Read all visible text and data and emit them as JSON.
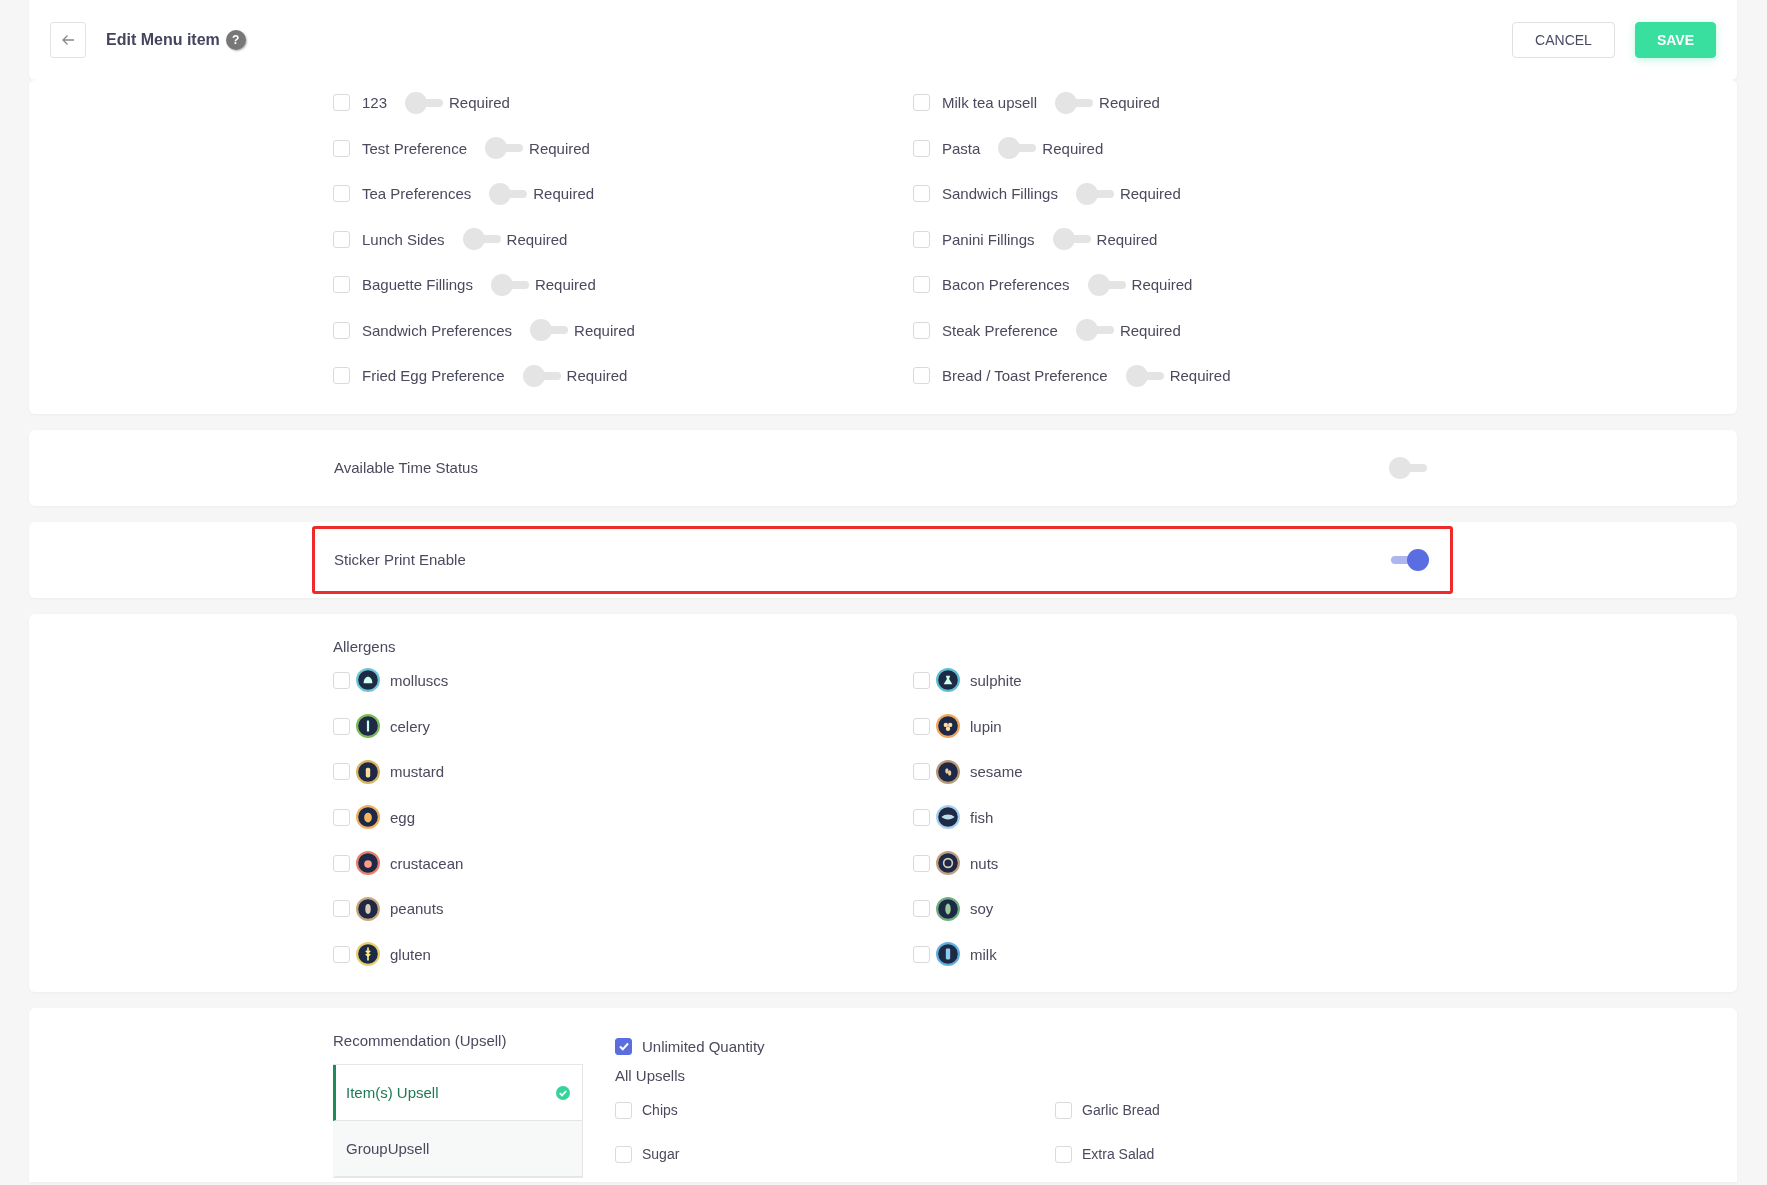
{
  "header": {
    "title": "Edit Menu item",
    "help_mark": "?",
    "buttons": [
      {
        "label": "CANCEL",
        "kind": "secondary"
      },
      {
        "label": "SAVE",
        "kind": "primary"
      }
    ]
  },
  "modifiers": [
    {
      "name": "123",
      "checked": false,
      "required": false,
      "required_label": "Required"
    },
    {
      "name": "Milk tea upsell",
      "checked": false,
      "required": false,
      "required_label": "Required"
    },
    {
      "name": "Test Preference",
      "checked": false,
      "required": false,
      "required_label": "Required"
    },
    {
      "name": "Pasta",
      "checked": false,
      "required": false,
      "required_label": "Required"
    },
    {
      "name": "Tea Preferences",
      "checked": false,
      "required": false,
      "required_label": "Required"
    },
    {
      "name": "Sandwich Fillings",
      "checked": false,
      "required": false,
      "required_label": "Required"
    },
    {
      "name": "Lunch Sides",
      "checked": false,
      "required": false,
      "required_label": "Required"
    },
    {
      "name": "Panini Fillings",
      "checked": false,
      "required": false,
      "required_label": "Required"
    },
    {
      "name": "Baguette Fillings",
      "checked": false,
      "required": false,
      "required_label": "Required"
    },
    {
      "name": "Bacon Preferences",
      "checked": false,
      "required": false,
      "required_label": "Required"
    },
    {
      "name": "Sandwich Preferences",
      "checked": false,
      "required": false,
      "required_label": "Required"
    },
    {
      "name": "Steak Preference",
      "checked": false,
      "required": false,
      "required_label": "Required"
    },
    {
      "name": "Fried Egg Preference",
      "checked": false,
      "required": false,
      "required_label": "Required"
    },
    {
      "name": "Bread / Toast Preference",
      "checked": false,
      "required": false,
      "required_label": "Required"
    }
  ],
  "settings": [
    {
      "label": "Available Time Status",
      "on": false,
      "highlighted": false
    },
    {
      "label": "Sticker Print Enable",
      "on": true,
      "highlighted": true
    }
  ],
  "allergens": {
    "title": "Allergens",
    "items": [
      {
        "name": "molluscs",
        "checked": false,
        "color": "#6ec6d6"
      },
      {
        "name": "sulphite",
        "checked": false,
        "color": "#5fbfd0"
      },
      {
        "name": "celery",
        "checked": false,
        "color": "#7dbb5a"
      },
      {
        "name": "lupin",
        "checked": false,
        "color": "#f0a860"
      },
      {
        "name": "mustard",
        "checked": false,
        "color": "#d8b45e"
      },
      {
        "name": "sesame",
        "checked": false,
        "color": "#b89878"
      },
      {
        "name": "egg",
        "checked": false,
        "color": "#f0b060"
      },
      {
        "name": "fish",
        "checked": false,
        "color": "#a8d0f0"
      },
      {
        "name": "crustacean",
        "checked": false,
        "color": "#e8806a"
      },
      {
        "name": "nuts",
        "checked": false,
        "color": "#c0a080"
      },
      {
        "name": "peanuts",
        "checked": false,
        "color": "#c9a77a"
      },
      {
        "name": "soy",
        "checked": false,
        "color": "#70b080"
      },
      {
        "name": "gluten",
        "checked": false,
        "color": "#e8d070"
      },
      {
        "name": "milk",
        "checked": false,
        "color": "#60b0e0"
      }
    ]
  },
  "upsell": {
    "title": "Recommendation (Upsell)",
    "tabs": [
      {
        "label": "Item(s) Upsell",
        "selected": true,
        "complete": true
      },
      {
        "label": "GroupUpsell",
        "selected": false,
        "complete": false
      }
    ],
    "unlimited_quantity": {
      "label": "Unlimited Quantity",
      "checked": true
    },
    "list_title": "All Upsells",
    "items": [
      {
        "name": "Chips",
        "checked": false
      },
      {
        "name": "Garlic Bread",
        "checked": false
      },
      {
        "name": "Sugar",
        "checked": false
      },
      {
        "name": "Extra Salad",
        "checked": false
      }
    ]
  }
}
